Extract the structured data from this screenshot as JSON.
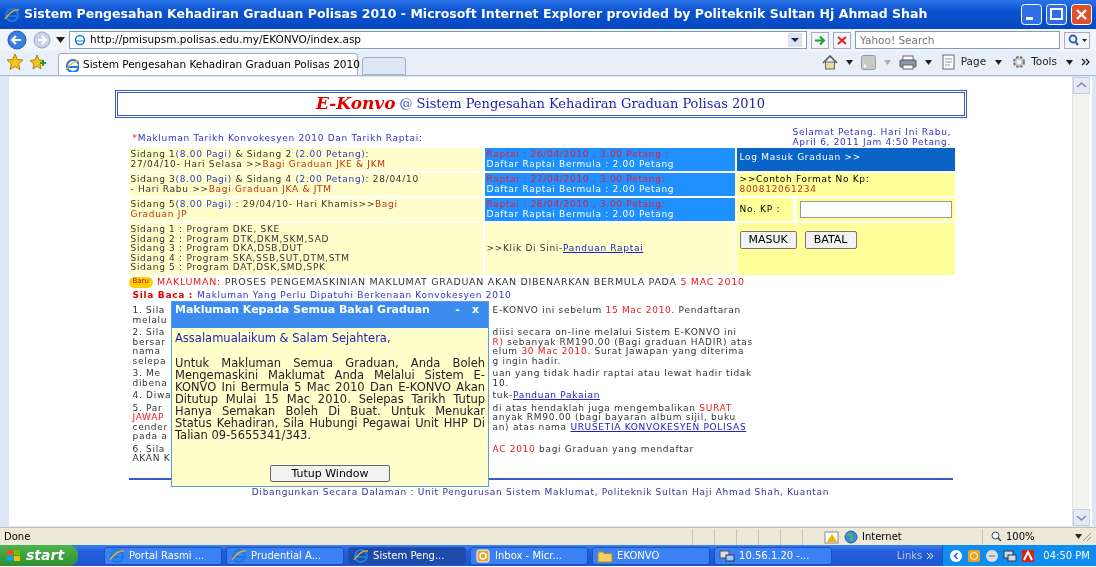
{
  "window": {
    "title": "Sistem Pengesahan Kehadiran Graduan Polisas 2010 - Microsoft Internet Explorer provided by Politeknik Sultan Hj Ahmad Shah"
  },
  "address_bar": {
    "url": "http://pmisupsm.polisas.edu.my/EKONVO/index.asp",
    "search_placeholder": "Yahoo! Search"
  },
  "tabs": [
    {
      "label": "Sistem Pengesahan Kehadiran Graduan Polisas 2010",
      "selected": true
    }
  ],
  "command_bar": [
    "Page",
    "Tools"
  ],
  "page": {
    "brand": "E-Konvo",
    "at": "@",
    "heading": "Sistem Pengesahan Kehadiran Graduan Polisas 2010",
    "schedule_title": [
      {
        "text": "*",
        "kind": "red"
      },
      {
        "text": "Makluman Tarikh Konvokesyen 2010 Dan Tarikh Raptai:",
        "kind": "blue"
      }
    ],
    "greeting": "Selamat Petang. Hari Ini Rabu, April 6, 2011 Jam 4:50 Petang.",
    "sessions": [
      {
        "info": [
          [
            {
              "text": "Sidang 1",
              "kind": "plain"
            },
            {
              "text": "(8.00 Pagi)",
              "kind": "blue"
            },
            {
              "text": " & Sidang 2 ",
              "kind": "plain"
            },
            {
              "text": "(2.00 Petang)",
              "kind": "blue"
            },
            {
              "text": ":",
              "kind": "plain"
            }
          ],
          [
            {
              "text": "27/04/10- Hari Selasa >>",
              "kind": "plain"
            },
            {
              "text": "Bagi Graduan JKE & JKM",
              "kind": "darkred"
            }
          ]
        ],
        "raptai": "Raptai : 26/04/2010 , 3.00 Petang :",
        "daftar": "Daftar Raptai Bermula : 2.00 Petang"
      },
      {
        "info": [
          [
            {
              "text": "Sidang 3",
              "kind": "plain"
            },
            {
              "text": "(8.00 Pagi)",
              "kind": "blue"
            },
            {
              "text": " & Sidang 4 ",
              "kind": "plain"
            },
            {
              "text": "(2.00 Petang)",
              "kind": "blue"
            },
            {
              "text": ": 28/04/10",
              "kind": "plain"
            }
          ],
          [
            {
              "text": "- Hari Rabu >>",
              "kind": "plain"
            },
            {
              "text": "Bagi Graduan JKA & JTM",
              "kind": "darkred"
            }
          ]
        ],
        "raptai": "Raptai : 27/04/2010 , 3.00 Petang:",
        "daftar": "Daftar Raptai Bermula : 2.00 Petang"
      },
      {
        "info": [
          [
            {
              "text": "Sidang 5",
              "kind": "plain"
            },
            {
              "text": "(8.00 Pagi)",
              "kind": "blue"
            },
            {
              "text": " : 29/04/10- Hari Khamis>>",
              "kind": "plain"
            },
            {
              "text": "Bagi",
              "kind": "darkred"
            }
          ],
          [
            {
              "text": "Graduan JP",
              "kind": "darkred"
            }
          ]
        ],
        "raptai": "Raptai : 28/04/2010 , 3.00 Petang:",
        "daftar": "Daftar Raptai Bermula : 2.00 Petang"
      }
    ],
    "programs": [
      "Sidang 1 : Program DKE, SKE",
      "Sidang 2 : Program DTK,DKM,SKM,SAD",
      "Sidang 3 : Program DKA,DSB,DUT",
      "Sidang 4 : Program SKA,SSB,SUT,DTM,STM",
      "Sidang 5 : Program DAT,DSK,SMD,SPK"
    ],
    "guide": {
      "prefix": ">>Klik Di Sini-",
      "link": "Panduan Raptai"
    },
    "login": {
      "title": "Log Masuk Graduan >>",
      "format_label": ">>Contoh Format No Kp:",
      "format_example": "800812061234",
      "kp_label": "No. KP :",
      "buttons": [
        "MASUK",
        "BATAL"
      ]
    },
    "badge": "Baru",
    "announcement": [
      {
        "text": "MAKLUMAN: ",
        "kind": "red"
      },
      {
        "text": "PROSES PENGEMASKINIAN MAKLUMAT GRADUAN AKAN DIBENARKAN BERMULA PADA ",
        "kind": "plain"
      },
      {
        "text": "5 MAC 2010",
        "kind": "red"
      }
    ],
    "read_notice": [
      {
        "text": "Sila Baca : ",
        "kind": "redbold"
      },
      {
        "text": "Makluman Yang Perlu Dipatuhi Berkenaan Konvokesyen 2010",
        "kind": "blue"
      }
    ],
    "notices": [
      [
        {
          "left": "1. Sila",
          "right": [
            {
              "text": "E-KONVO ini sebelum ",
              "kind": "plain"
            },
            {
              "text": "15 Mac 2010",
              "kind": "red"
            },
            {
              "text": ". Pendaftaran",
              "kind": "plain"
            }
          ]
        },
        {
          "left": "melalu"
        }
      ],
      [
        {
          "left": "2. Sila",
          "right": [
            {
              "text": "diisi secara on-line melalui Sistem E-KONVO ini",
              "kind": "plain"
            }
          ]
        },
        {
          "left": "bersar",
          "right": [
            {
              "text": "R)",
              "kind": "red"
            },
            {
              "text": " sebanyak RM190.00 (Bagi graduan HADIR) atas",
              "kind": "plain"
            }
          ]
        },
        {
          "left": "nama",
          "right": [
            {
              "text": "elum ",
              "kind": "plain"
            },
            {
              "text": "30 Mac 2010",
              "kind": "red"
            },
            {
              "text": ". Surat Jawapan yang diterima",
              "kind": "plain"
            }
          ]
        },
        {
          "left": "selepa",
          "right": [
            {
              "text": "g ingin hadir.",
              "kind": "plain"
            }
          ]
        }
      ],
      [
        {
          "left": "3. Me",
          "right": [
            {
              "text": "uan yang tidak hadir raptai atau lewat hadir tidak",
              "kind": "plain"
            }
          ]
        },
        {
          "left": "dibena",
          "right": [
            {
              "text": "10.",
              "kind": "plain"
            }
          ]
        }
      ],
      [
        {
          "left": "4. Diwa",
          "right": [
            {
              "text": "tuk-",
              "kind": "plain"
            },
            {
              "text": "Panduan Pakaian",
              "kind": "link"
            }
          ]
        }
      ],
      [
        {
          "left": "5. Par",
          "right": [
            {
              "text": "di atas hendaklah juga mengembalikan ",
              "kind": "plain"
            },
            {
              "text": "SURAT",
              "kind": "red"
            }
          ]
        },
        {
          "left": "JAWAP",
          "left_highlight": true,
          "right": [
            {
              "text": "anyak RM90.00 (bagi bayaran album sijil, buku",
              "kind": "plain"
            }
          ]
        },
        {
          "left": "cender",
          "right": [
            {
              "text": "an) atas nama ",
              "kind": "plain"
            },
            {
              "text": "URUSETIA KONVOKESYEN POLISAS",
              "kind": "link"
            }
          ]
        },
        {
          "left": "pada a"
        }
      ],
      [
        {
          "left": "6. Sila",
          "right": [
            {
              "text": "AC 2010",
              "kind": "red"
            },
            {
              "text": " bagi Graduan yang mendaftar",
              "kind": "plain"
            }
          ]
        },
        {
          "left": "AKAN K"
        }
      ]
    ],
    "footer": "Dibangunkan Secara Dalaman : Unit Pengurusan Sistem Maklumat, Politeknik Sultan Haji Ahmad Shah, Kuantan"
  },
  "popup": {
    "title": "Makluman Kepada Semua Bakal Graduan",
    "minimize": "-",
    "close": "x",
    "greeting": "Assalamualaikum & Salam Sejahtera,",
    "body": "Untuk Makluman Semua Graduan, Anda Boleh Mengemaskini Maklumat Anda Melalui Sistem E-KONVO Ini Bermula 5 Mac 2010 Dan E-KONVO Akan Ditutup Mulai 15 Mac 2010. Selepas Tarikh Tutup Hanya Semakan Boleh Di Buat. Untuk Menukar Status Kehadiran, Sila Hubungi Pegawai Unit HHP Di Talian 09-5655341/343.",
    "button": "Tutup Window"
  },
  "status_bar": {
    "text": "Done",
    "zone": "Internet",
    "zoom": "100%"
  },
  "taskbar": {
    "start": "start",
    "items": [
      {
        "label": "Portal Rasmi ...",
        "kind": "browser",
        "selected": false
      },
      {
        "label": "Prudential A...",
        "kind": "browser",
        "selected": false
      },
      {
        "label": "Sistem Peng...",
        "kind": "browser",
        "selected": true
      },
      {
        "label": "Inbox - Micr...",
        "kind": "mail",
        "selected": false
      },
      {
        "label": "EKONVO",
        "kind": "folder",
        "selected": false
      },
      {
        "label": "10.56.1.20 -...",
        "kind": "remote",
        "selected": false
      }
    ],
    "links": "Links",
    "clock": "04:50 PM"
  }
}
